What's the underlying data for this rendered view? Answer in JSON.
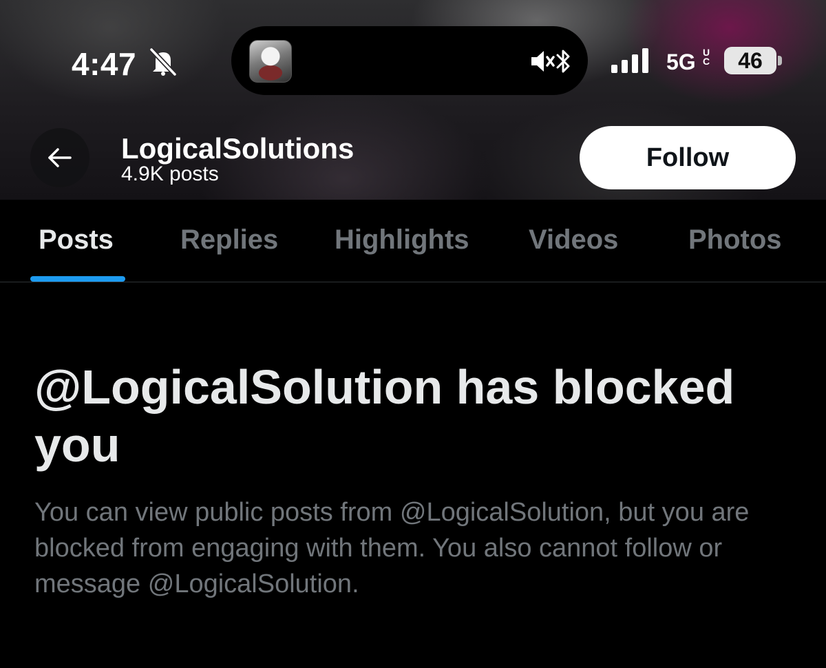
{
  "status_bar": {
    "time": "4:47",
    "network_type": "5G",
    "network_badge_top": "U",
    "network_badge_bottom": "C",
    "battery_level": "46",
    "icons": [
      "bell-off-icon",
      "mute-icon",
      "bluetooth-icon",
      "signal-icon"
    ]
  },
  "profile": {
    "name": "LogicalSolutions",
    "post_count": "4.9K posts",
    "follow_label": "Follow"
  },
  "tabs": [
    {
      "label": "Posts",
      "active": true
    },
    {
      "label": "Replies",
      "active": false
    },
    {
      "label": "Highlights",
      "active": false
    },
    {
      "label": "Videos",
      "active": false
    },
    {
      "label": "Photos",
      "active": false
    }
  ],
  "blocked": {
    "title": "@LogicalSolution has blocked you",
    "body": "You can view public posts from @LogicalSolution, but you are blocked from engaging with them. You also cannot follow or message @LogicalSolution."
  },
  "colors": {
    "background": "#000000",
    "accent": "#1d9bf0",
    "primary_text": "#e7e9ea",
    "secondary_text": "#71767b",
    "follow_button_bg": "#ffffff"
  }
}
